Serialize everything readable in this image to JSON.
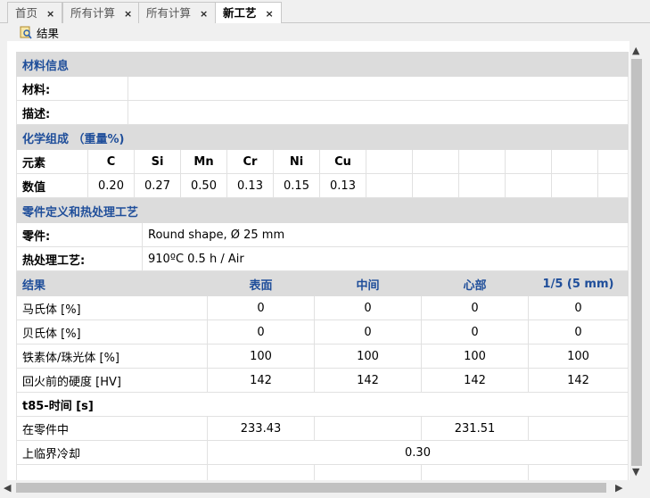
{
  "tabs": [
    {
      "label": "首页",
      "close": "×"
    },
    {
      "label": "所有计算",
      "close": "×"
    },
    {
      "label": "所有计算",
      "close": "×"
    },
    {
      "label": "新工艺",
      "close": "×"
    }
  ],
  "toolbar": {
    "result_label": "结果"
  },
  "material": {
    "section": "材料信息",
    "material_label": "材料:",
    "material_value": "",
    "desc_label": "描述:",
    "desc_value": ""
  },
  "chemistry": {
    "section": "化学组成 （重量%)",
    "element_label": "元素",
    "value_label": "数值",
    "elements": [
      "C",
      "Si",
      "Mn",
      "Cr",
      "Ni",
      "Cu"
    ],
    "values": [
      "0.20",
      "0.27",
      "0.50",
      "0.13",
      "0.15",
      "0.13"
    ]
  },
  "part": {
    "section": "零件定义和热处理工艺",
    "part_label": "零件:",
    "part_value": "Round shape, Ø 25 mm",
    "process_label": "热处理工艺:",
    "process_value": "910ºC 0.5 h / Air"
  },
  "results": {
    "header": [
      "结果",
      "表面",
      "中间",
      "心部",
      "1/5 (5 mm)"
    ],
    "rows": [
      {
        "label": "马氏体 [%]",
        "values": [
          "0",
          "0",
          "0",
          "0"
        ]
      },
      {
        "label": "贝氏体 [%]",
        "values": [
          "0",
          "0",
          "0",
          "0"
        ]
      },
      {
        "label": "铁素体/珠光体 [%]",
        "values": [
          "100",
          "100",
          "100",
          "100"
        ]
      },
      {
        "label": "回火前的硬度 [HV]",
        "values": [
          "142",
          "142",
          "142",
          "142"
        ]
      }
    ],
    "t85_label": "t85-时间 [s]",
    "in_part_label": "在零件中",
    "in_part_values": [
      "233.43",
      "",
      "231.51",
      ""
    ],
    "upper_critical_label": "上临界冷却",
    "upper_critical_value": "0.30"
  },
  "scroll": {
    "up": "▲",
    "down": "▼",
    "left": "◀",
    "right": "▶"
  }
}
